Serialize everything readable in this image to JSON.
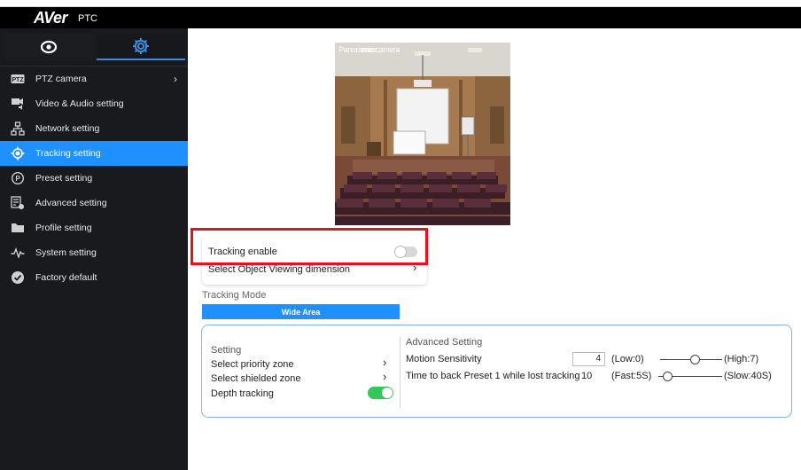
{
  "app": {
    "logo": "AVer",
    "product": "PTC"
  },
  "sidebar": {
    "tabs": [
      {
        "icon": "eye-icon"
      },
      {
        "icon": "gear-icon"
      }
    ],
    "items": [
      {
        "label": "PTZ camera",
        "icon": "ptz-icon"
      },
      {
        "label": "Video & Audio setting",
        "icon": "video-audio-icon"
      },
      {
        "label": "Network setting",
        "icon": "network-icon"
      },
      {
        "label": "Tracking setting",
        "icon": "tracking-icon"
      },
      {
        "label": "Preset setting",
        "icon": "preset-icon"
      },
      {
        "label": "Advanced setting",
        "icon": "advanced-icon"
      },
      {
        "label": "Profile setting",
        "icon": "folder-icon"
      },
      {
        "label": "System setting",
        "icon": "pulse-icon"
      },
      {
        "label": "Factory default",
        "icon": "check-circle-icon"
      }
    ],
    "active_index": 3
  },
  "preview": {
    "label": "Panoramic camera"
  },
  "tracking": {
    "enable_label": "Tracking enable",
    "enable_on": false,
    "object_dimension_label": "Select Object Viewing dimension",
    "mode_label": "Tracking Mode",
    "mode_value": "Wide Area"
  },
  "setting": {
    "title": "Setting",
    "priority_zone": "Select priority zone",
    "shielded_zone": "Select shielded zone",
    "depth_tracking": "Depth tracking",
    "depth_tracking_on": true
  },
  "advanced": {
    "title": "Advanced Setting",
    "motion_label": "Motion Sensitivity",
    "motion_value": "4",
    "motion_low": "(Low:0)",
    "motion_high": "(High:7)",
    "motion_level": 0.57,
    "preset_label": "Time to back Preset 1 while lost tracking",
    "preset_value": "10",
    "preset_fast": "(Fast:5S)",
    "preset_slow": "(Slow:40S)",
    "preset_level": 0.14
  },
  "colors": {
    "accent": "#1e90ff",
    "highlight": "#e8101a",
    "toggle_on": "#34c759"
  }
}
